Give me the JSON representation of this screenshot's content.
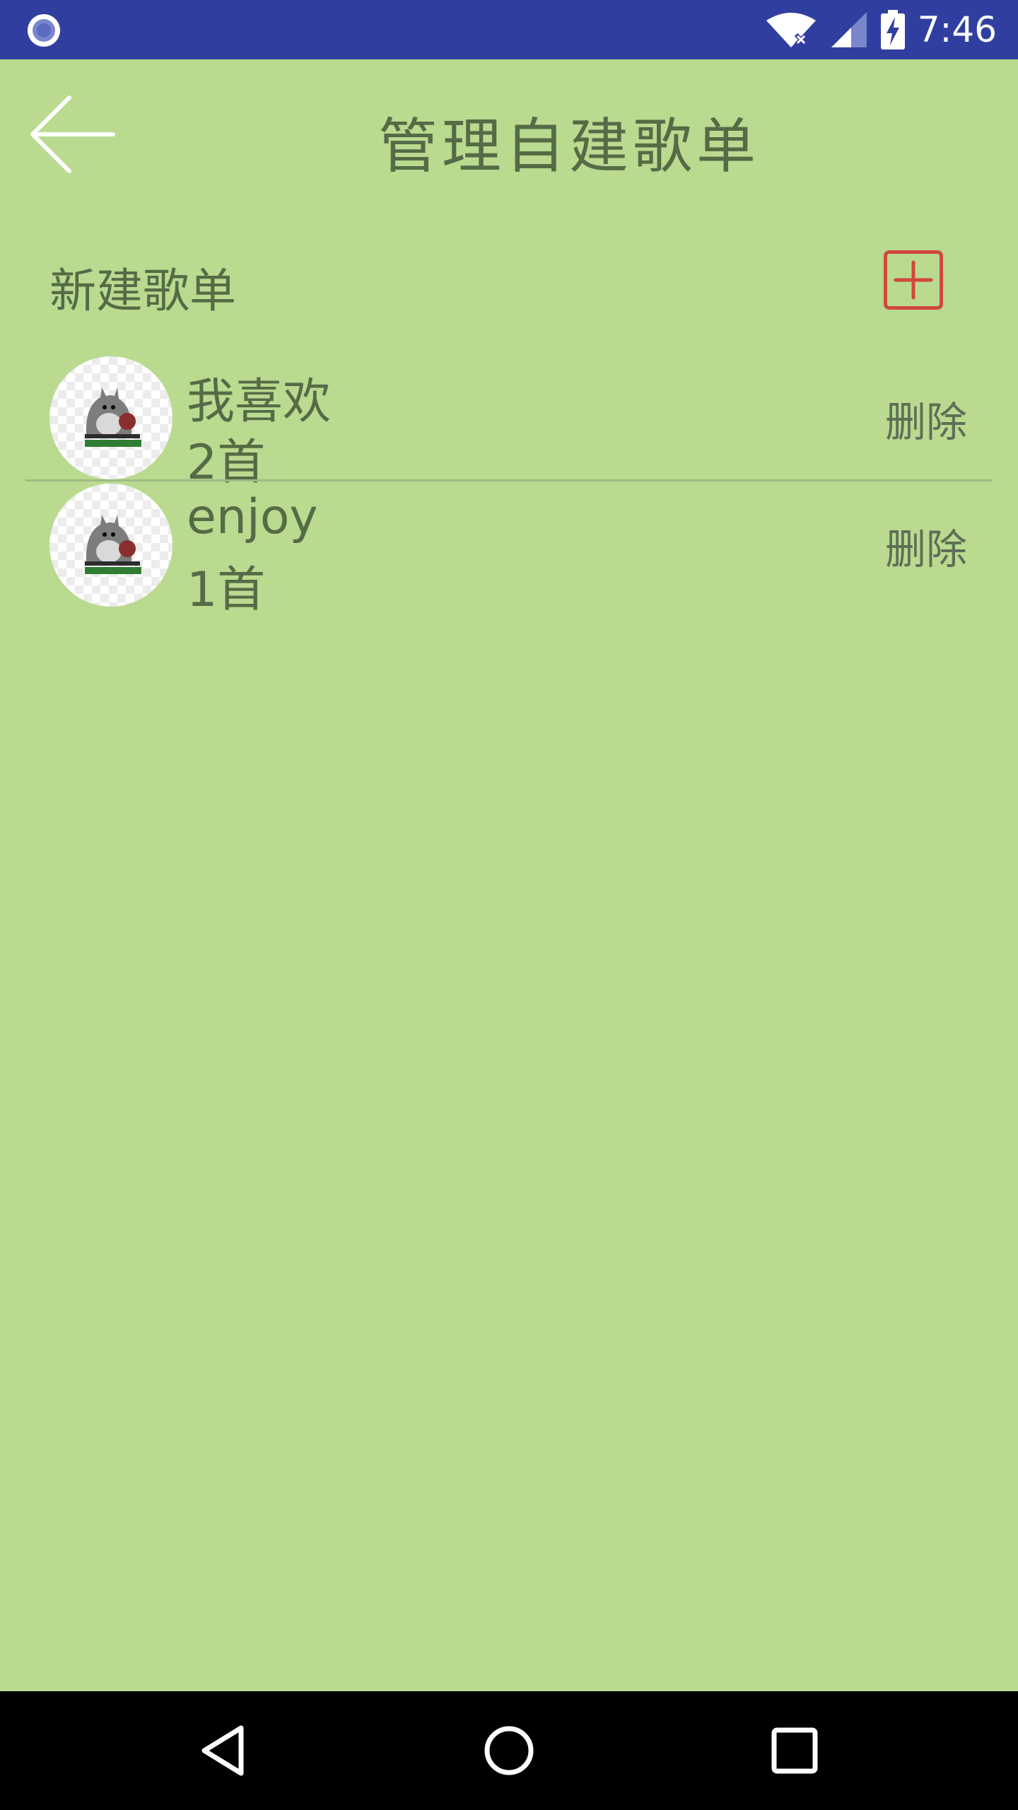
{
  "status_bar": {
    "time": "7:46",
    "left_icon": "app-notification-icon",
    "icons": [
      "wifi-x-icon",
      "signal-icon",
      "battery-charging-icon"
    ]
  },
  "header": {
    "title": "管理自建歌单",
    "back_icon": "back-arrow-icon"
  },
  "new_playlist": {
    "label": "新建歌单",
    "add_icon": "add-square-icon"
  },
  "playlists": [
    {
      "name": "我喜欢",
      "count": "2首",
      "delete_label": "删除",
      "cover_icon": "totoro-cover-icon"
    },
    {
      "name": "enjoy",
      "count": "1首",
      "delete_label": "删除",
      "cover_icon": "totoro-cover-icon"
    }
  ],
  "nav_bar": {
    "buttons": [
      "back-triangle-icon",
      "home-circle-icon",
      "recents-square-icon"
    ]
  },
  "colors": {
    "background": "#b9da8f",
    "status_bar": "#303f9f",
    "text": "#546b46",
    "accent_red": "#d2473d"
  }
}
